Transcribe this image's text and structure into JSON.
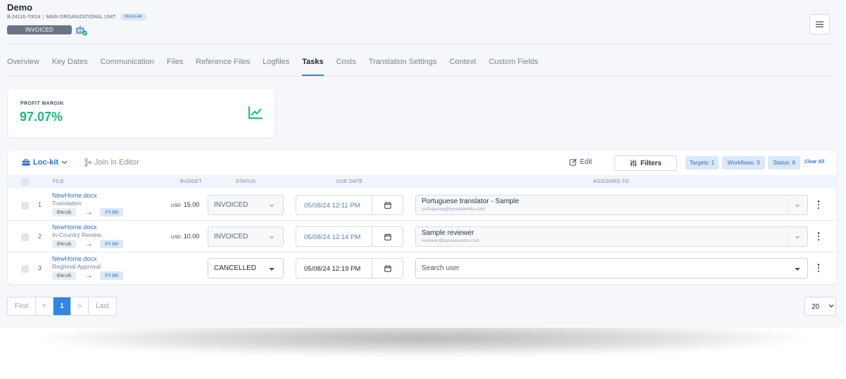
{
  "project": {
    "title": "Demo",
    "code": "B-24116-70014",
    "unit": "MAIN ORGANIZATIONAL UNIT",
    "unit_separator": "|",
    "tag": "REGULAR",
    "status": "INVOICED"
  },
  "tabs": [
    {
      "label": "Overview",
      "active": false
    },
    {
      "label": "Key Dates",
      "active": false
    },
    {
      "label": "Communication",
      "active": false
    },
    {
      "label": "Files",
      "active": false
    },
    {
      "label": "Reference Files",
      "active": false
    },
    {
      "label": "Logfiles",
      "active": false
    },
    {
      "label": "Tasks",
      "active": true
    },
    {
      "label": "Costs",
      "active": false
    },
    {
      "label": "Translation Settings",
      "active": false
    },
    {
      "label": "Context",
      "active": false
    },
    {
      "label": "Custom Fields",
      "active": false
    }
  ],
  "profit": {
    "label": "PROFIT MARGIN",
    "value": "97.07%",
    "color": "#1bb97a"
  },
  "toolbar": {
    "lockit": "Loc-kit",
    "join": "Join in Editor",
    "edit": "Edit",
    "filters": "Filters",
    "chips": [
      "Targets: 1",
      "Workflows: 3",
      "Status: 6"
    ],
    "clear_all": "Clear All"
  },
  "table": {
    "headers": {
      "file": "FILE",
      "budget": "BUDGET",
      "status": "STATUS",
      "due_date": "DUE DATE",
      "assigned_to": "ASSIGNED TO"
    },
    "rows": [
      {
        "num": "1",
        "file": "NewHome.docx",
        "task": "Translation",
        "source": "EN-US",
        "target": "PT-BR",
        "currency": "USD",
        "budget": "15.00",
        "status": "INVOICED",
        "due": "05/08/24 12:11 PM",
        "assignee": "Portuguese translator - Sample",
        "email": "portuguese@bureauworks.com"
      },
      {
        "num": "2",
        "file": "NewHome.docx",
        "task": "In-Country Review",
        "source": "EN-US",
        "target": "PT-BR",
        "currency": "USD",
        "budget": "10.00",
        "status": "INVOICED",
        "due": "05/08/24 12:14 PM",
        "assignee": "Sample reviewer",
        "email": "reviewer@bureauworks.com"
      },
      {
        "num": "3",
        "file": "NewHome.docx",
        "task": "Regional Approval",
        "source": "EN-US",
        "target": "PT-BR",
        "status": "CANCELLED",
        "due": "05/08/24 12:19 PM",
        "assignee_placeholder": "Search user"
      }
    ]
  },
  "pagination": {
    "first": "First",
    "prev": "<",
    "current": "1",
    "next": ">",
    "last": "Last",
    "page_size": "20"
  },
  "colors": {
    "accent": "#2f86e4",
    "link": "#2f6fcf",
    "status_pill": "#6b7486"
  }
}
